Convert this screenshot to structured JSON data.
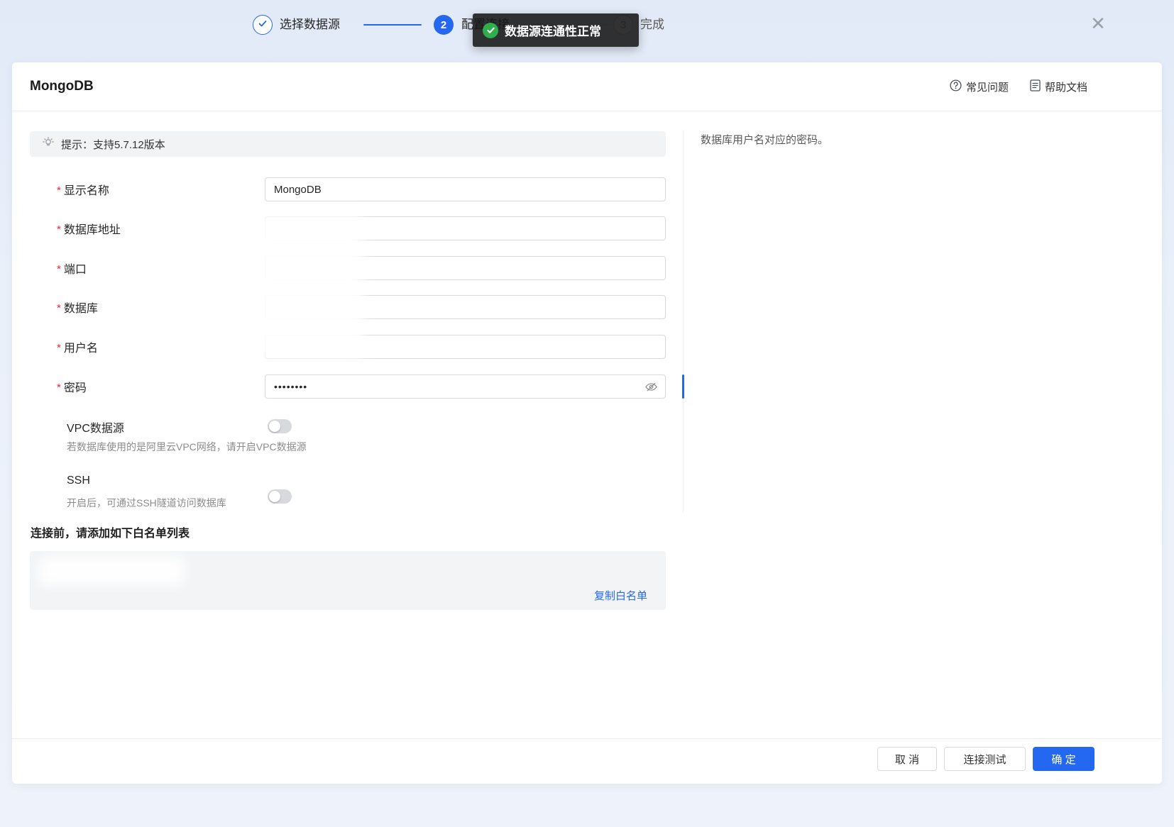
{
  "window": {
    "close_glyph": "✕"
  },
  "stepper": {
    "step1_label": "选择数据源",
    "step2_number": "2",
    "step2_label": "配置连接",
    "step3_number": "3",
    "step3_label": "完成"
  },
  "toast": {
    "message": "数据源连通性正常"
  },
  "header": {
    "title": "MongoDB",
    "faq_label": "常见问题",
    "help_label": "帮助文档"
  },
  "tip": {
    "text": "提示：支持5.7.12版本"
  },
  "form": {
    "required_mark": "*",
    "display_name": {
      "label": "显示名称",
      "value": "MongoDB"
    },
    "db_address": {
      "label": "数据库地址",
      "value": ""
    },
    "port": {
      "label": "端口",
      "value": ""
    },
    "database": {
      "label": "数据库",
      "value": ""
    },
    "username": {
      "label": "用户名",
      "value": ""
    },
    "password": {
      "label": "密码",
      "value": "••••••••"
    },
    "vpc": {
      "label": "VPC数据源",
      "helper": "若数据库使用的是阿里云VPC网络，请开启VPC数据源"
    },
    "ssh": {
      "label": "SSH",
      "helper": "开启后，可通过SSH隧道访问数据库"
    }
  },
  "side_help": {
    "text": "数据库用户名对应的密码。"
  },
  "whitelist": {
    "title": "连接前，请添加如下白名单列表",
    "copy_label": "复制白名单"
  },
  "footer": {
    "cancel_label": "取 消",
    "test_label": "连接测试",
    "confirm_label": "确 定"
  },
  "colors": {
    "primary": "#2468f2",
    "success": "#2fae4d",
    "danger": "#f5222d",
    "toast_bg": "#161616"
  }
}
